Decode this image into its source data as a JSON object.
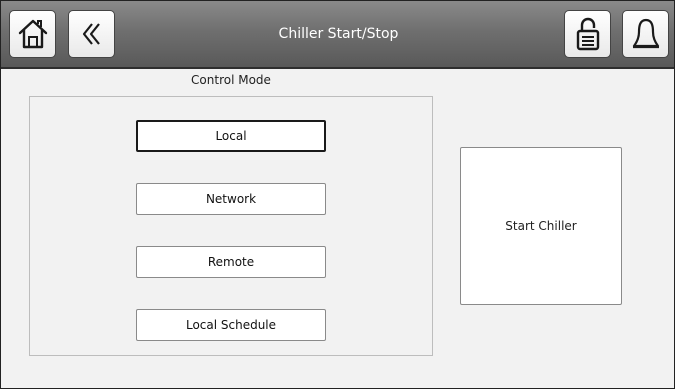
{
  "header": {
    "title": "Chiller Start/Stop",
    "icons": {
      "home": "home-icon",
      "back": "chevron-left-icon",
      "lock": "unlocked-padlock-icon",
      "alarm": "bell-icon"
    }
  },
  "control_mode": {
    "label": "Control Mode",
    "selected": "Local",
    "options": [
      {
        "label": "Local"
      },
      {
        "label": "Network"
      },
      {
        "label": "Remote"
      },
      {
        "label": "Local Schedule"
      }
    ]
  },
  "start_button": {
    "label": "Start Chiller"
  },
  "colors": {
    "titlebar": "#6f6f6f",
    "background": "#f2f2f2",
    "button": "#ffffff"
  }
}
